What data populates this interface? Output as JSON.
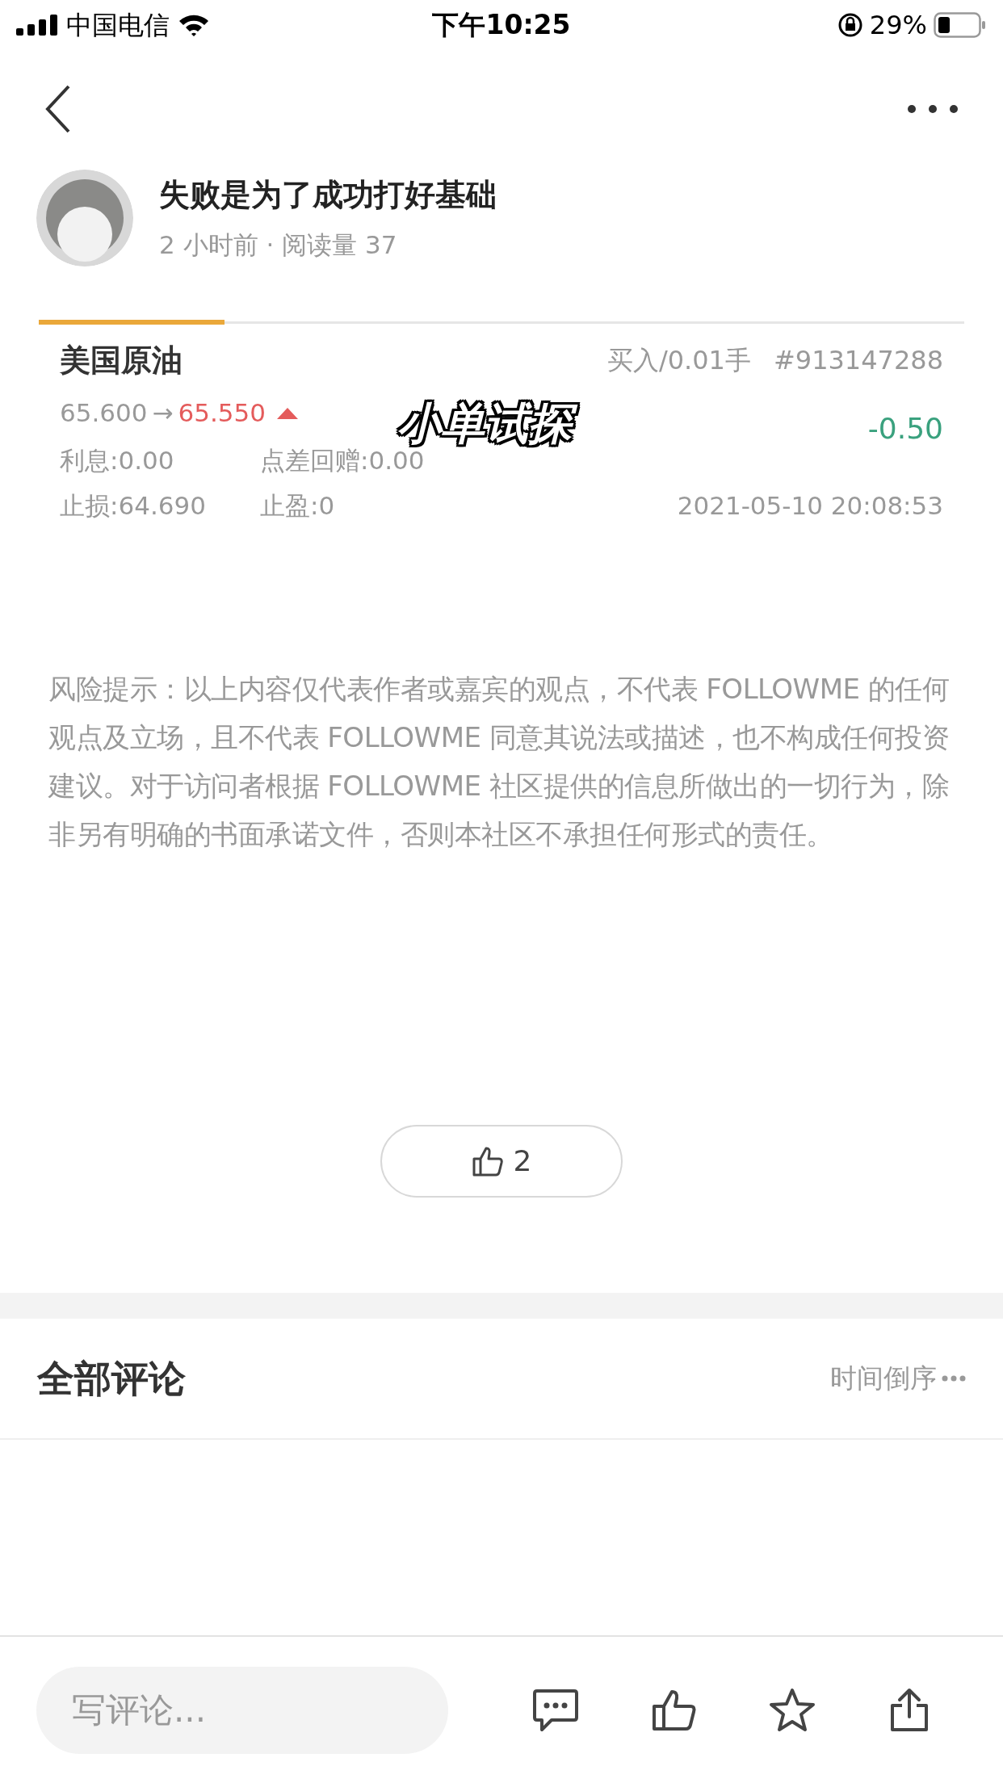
{
  "status_bar": {
    "carrier": "中国电信",
    "time": "下午10:25",
    "battery": "29%"
  },
  "author": {
    "name": "失败是为了成功打好基础",
    "meta": "2 小时前 · 阅读量 37"
  },
  "trade_card": {
    "symbol": "美国原油",
    "order": "买入/0.01手",
    "ticket": "#913147288",
    "open_price": "65.600",
    "arrow": "→",
    "current_price": "65.550",
    "price_up": true,
    "profit": "-0.50",
    "interest": "利息:0.00",
    "spread_rebate": "点差回赠:0.00",
    "stop_loss": "止损:64.690",
    "take_profit": "止盈:0",
    "time": "2021-05-10 20:08:53",
    "sticker": "小单试探"
  },
  "disclaimer": "风险提示：以上内容仅代表作者或嘉宾的观点，不代表 FOLLOWME 的任何观点及立场，且不代表 FOLLOWME 同意其说法或描述，也不构成任何投资建议。对于访问者根据 FOLLOWME 社区提供的信息所做出的一切行为，除非另有明确的书面承诺文件，否则本社区不承担任何形式的责任。",
  "like_button": {
    "count": "2"
  },
  "comments": {
    "title": "全部评论",
    "sort": "时间倒序"
  },
  "bottom_bar": {
    "placeholder": "写评论..."
  }
}
